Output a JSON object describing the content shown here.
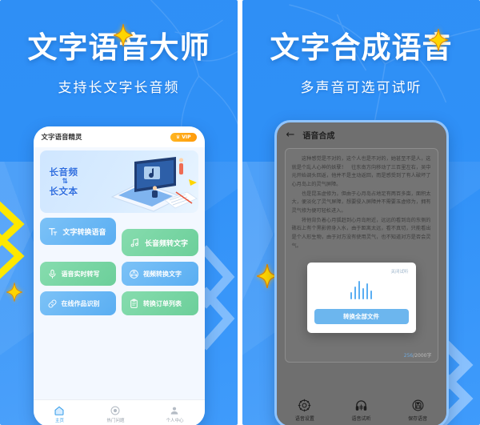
{
  "panels": {
    "left": {
      "title": "文字语音大师",
      "subtitle": "支持长文字长音频",
      "app": {
        "header_title": "文字语音精灵",
        "vip_badge": "VIP",
        "crown_icon": "crown-icon",
        "banner": {
          "line1": "长音频",
          "arrow": "⇅",
          "line2": "长文本",
          "illustration_icon": "laptop-music-illustration"
        },
        "primary_buttons": [
          {
            "label": "文字转换语音",
            "icon": "text-to-speech-icon",
            "color": "#5aaef2"
          },
          {
            "label": "长音频转文字",
            "icon": "music-note-icon",
            "color": "#6ccf9a"
          }
        ],
        "secondary_buttons": [
          {
            "label": "语音实时转写",
            "icon": "microphone-icon",
            "color": "#6ccf9a"
          },
          {
            "label": "视频转换文字",
            "icon": "film-reel-icon",
            "color": "#5aaef2"
          },
          {
            "label": "在线作品识别",
            "icon": "link-icon",
            "color": "#5aaef2"
          },
          {
            "label": "转换订单列表",
            "icon": "clipboard-icon",
            "color": "#6ccf9a"
          }
        ],
        "tabs": [
          {
            "label": "主页",
            "icon": "home-icon",
            "active": true
          },
          {
            "label": "热门问题",
            "icon": "help-circle-icon",
            "active": false
          },
          {
            "label": "个人中心",
            "icon": "person-icon",
            "active": false
          }
        ]
      }
    },
    "right": {
      "title": "文字合成语音",
      "subtitle": "多声音可选可试听",
      "app": {
        "back_icon": "back-arrow-icon",
        "header_title": "语音合成",
        "paragraphs": [
          "这种感觉是不对的，这个人也是不对的，她甚至不是人，这就是个乱人心神的妖孽！　往东南方向移动了三百里左右，吴中元开始调头回返，他并不是主动返回，而是感受到了有人破坏了心月岛上的灵气屏障。",
          "也是昆玉虚修为，但由于心月岛占地足有两百多亩，面积太大，便淡化了灵气屏障，想要侵入屏障并不需要玉虚修为，拥有灵气修为便可轻松进入。",
          "将他背负着心月狐赶到心月岛附近，远远的看到岛的东侧的礁石上有个黑影俯身入水，由于距离太远，看不真切，只能看出是个人形生物，由于对方没有使用灵气，也不知道对方是否会灵气。"
        ],
        "char_count_current": "256",
        "char_count_total": "/2000字",
        "modal": {
          "close_label": "关闭试听",
          "waveform_icon": "audio-waveform-icon",
          "action_label": "转换全部文件"
        },
        "tabs": [
          {
            "label": "语音设置",
            "icon": "gear-icon"
          },
          {
            "label": "语音试听",
            "icon": "headphones-icon"
          },
          {
            "label": "保存语音",
            "icon": "floppy-save-icon"
          }
        ]
      }
    }
  },
  "decorations": {
    "sparkle_icon": "sparkle-star-icon",
    "chevron_icon": "chevron-decoration-icon",
    "accent_yellow": "#ffd500",
    "accent_blue": "#2f8ff5",
    "brand_blue": "#3aa0ea"
  }
}
